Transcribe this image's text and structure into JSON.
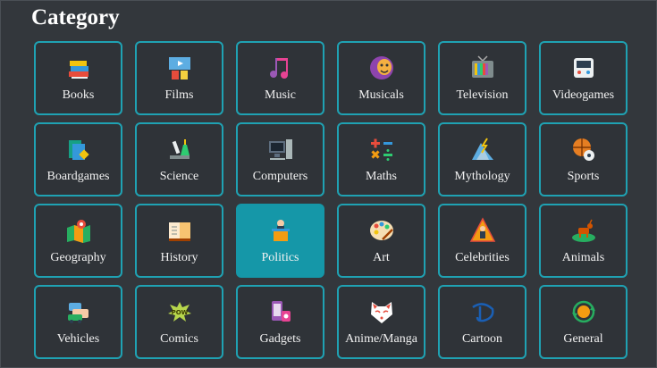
{
  "header": {
    "title": "Category"
  },
  "categories": [
    {
      "label": "Books",
      "icon": "books-icon"
    },
    {
      "label": "Films",
      "icon": "films-icon"
    },
    {
      "label": "Music",
      "icon": "music-icon"
    },
    {
      "label": "Musicals",
      "icon": "musicals-icon"
    },
    {
      "label": "Television",
      "icon": "television-icon"
    },
    {
      "label": "Videogames",
      "icon": "videogames-icon"
    },
    {
      "label": "Boardgames",
      "icon": "boardgames-icon"
    },
    {
      "label": "Science",
      "icon": "science-icon"
    },
    {
      "label": "Computers",
      "icon": "computers-icon"
    },
    {
      "label": "Maths",
      "icon": "maths-icon"
    },
    {
      "label": "Mythology",
      "icon": "mythology-icon"
    },
    {
      "label": "Sports",
      "icon": "sports-icon"
    },
    {
      "label": "Geography",
      "icon": "geography-icon"
    },
    {
      "label": "History",
      "icon": "history-icon"
    },
    {
      "label": "Politics",
      "icon": "politics-icon",
      "selected": true
    },
    {
      "label": "Art",
      "icon": "art-icon"
    },
    {
      "label": "Celebrities",
      "icon": "celebrities-icon"
    },
    {
      "label": "Animals",
      "icon": "animals-icon"
    },
    {
      "label": "Vehicles",
      "icon": "vehicles-icon"
    },
    {
      "label": "Comics",
      "icon": "comics-icon"
    },
    {
      "label": "Gadgets",
      "icon": "gadgets-icon"
    },
    {
      "label": "Anime/Manga",
      "icon": "anime-manga-icon"
    },
    {
      "label": "Cartoon",
      "icon": "cartoon-icon"
    },
    {
      "label": "General",
      "icon": "general-icon"
    }
  ],
  "colors": {
    "background": "#33373c",
    "accent": "#1fa2b3",
    "selected": "#1597a8",
    "text": "#f1f1f1"
  }
}
